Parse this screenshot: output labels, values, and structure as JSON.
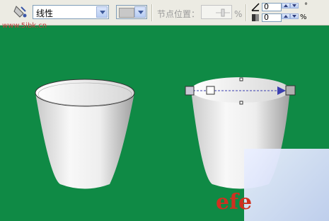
{
  "toolbar": {
    "fill_type_value": "线性",
    "node_position_label": "节点位置：",
    "percent_sign": "%",
    "angle_value": "0",
    "degree_sign": "°",
    "edge_value": "0",
    "edge_percent": "%"
  },
  "watermark": {
    "text": "www.5ibk.cn"
  },
  "logo": {
    "text": "efe"
  },
  "colors": {
    "background": "#0f8a45",
    "toolbar": "#ecebe3",
    "accent": "#3e5a9a"
  }
}
